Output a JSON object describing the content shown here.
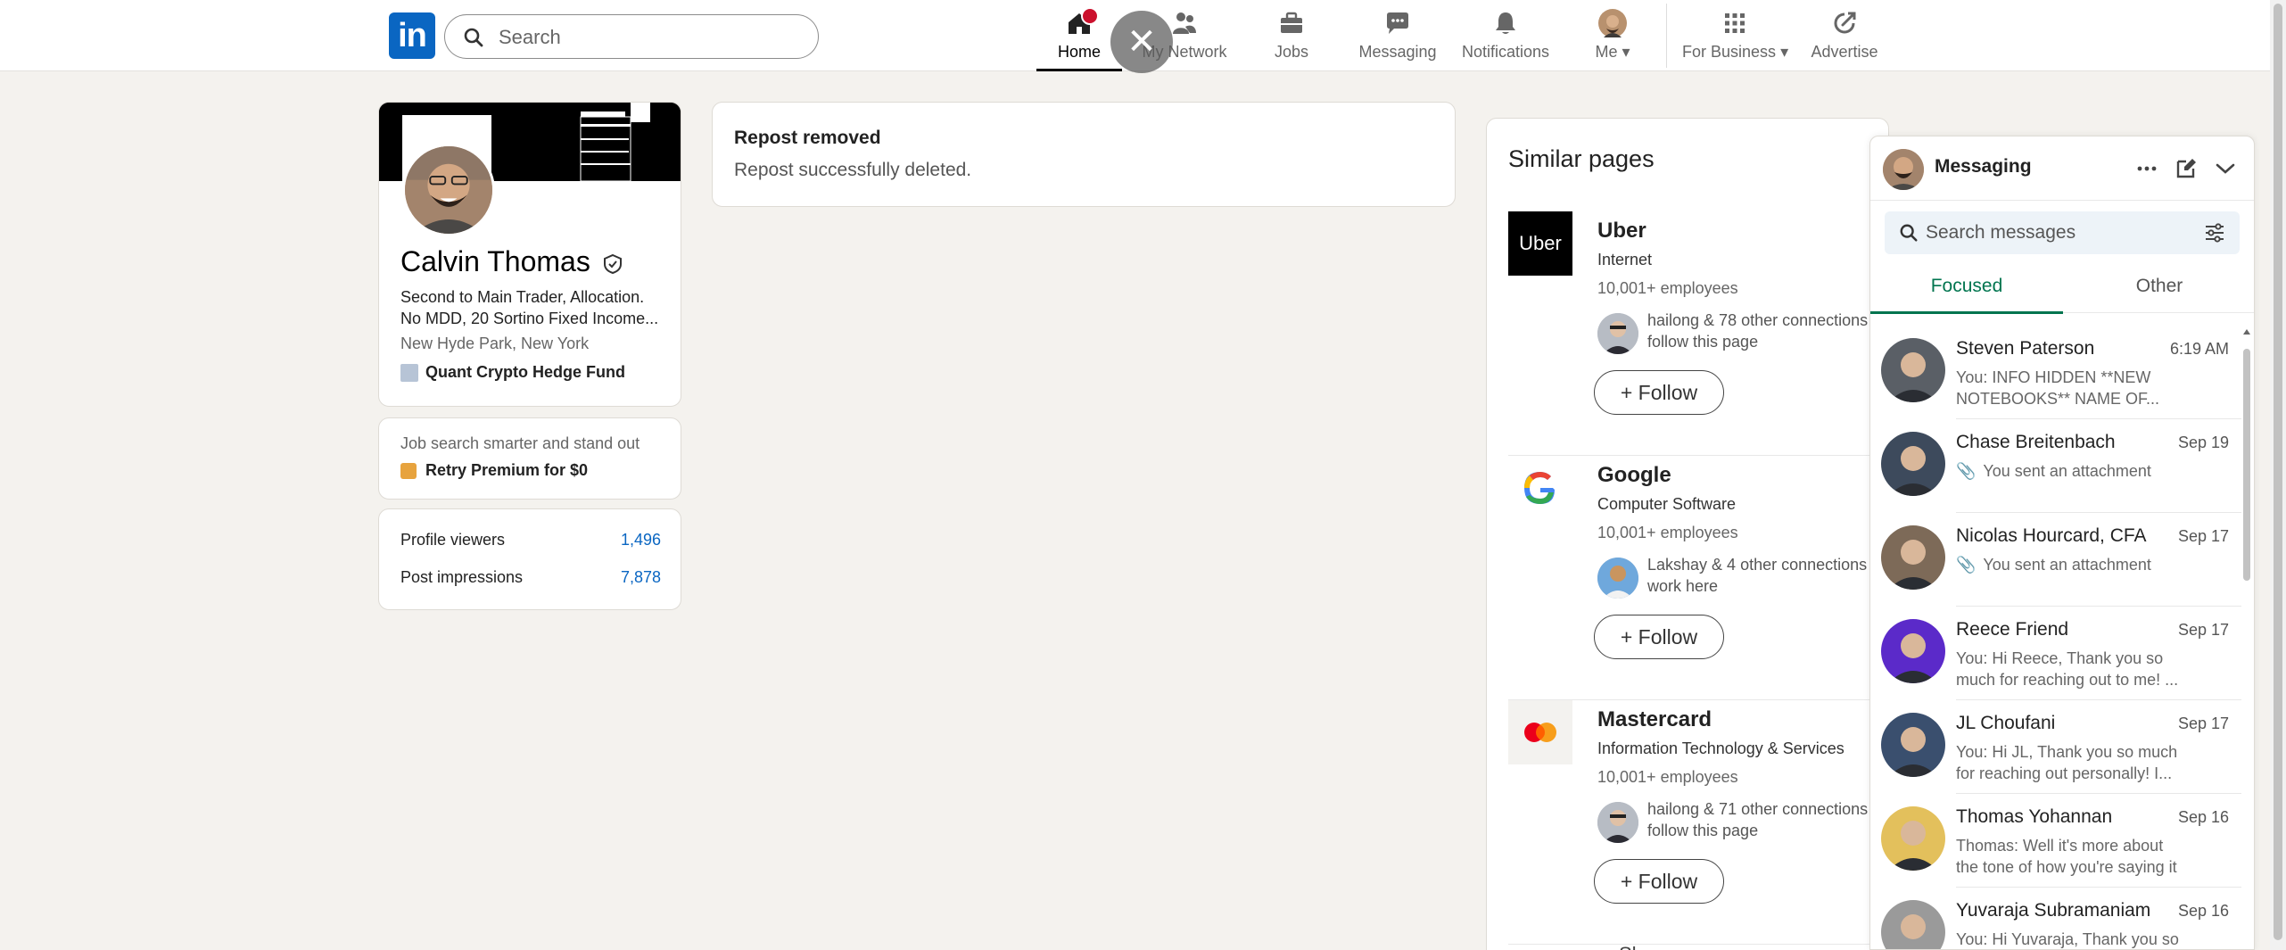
{
  "nav": {
    "logo": "in",
    "search_placeholder": "Search",
    "items": [
      {
        "label": "Home"
      },
      {
        "label": "My Network"
      },
      {
        "label": "Jobs"
      },
      {
        "label": "Messaging"
      },
      {
        "label": "Notifications"
      },
      {
        "label": "Me"
      },
      {
        "label": "For Business"
      },
      {
        "label": "Advertise"
      }
    ]
  },
  "profile": {
    "name": "Calvin Thomas",
    "headline": "Second to Main Trader, Allocation. No MDD, 20 Sortino Fixed Income...",
    "location": "New Hyde Park, New York",
    "org": "Quant Crypto Hedge Fund"
  },
  "premium": {
    "line": "Job search smarter and stand out",
    "cta": "Retry Premium for $0"
  },
  "stats": [
    {
      "label": "Profile viewers",
      "value": "1,496"
    },
    {
      "label": "Post impressions",
      "value": "7,878"
    }
  ],
  "toast": {
    "title": "Repost removed",
    "body": "Repost successfully deleted."
  },
  "similar": {
    "title": "Similar pages",
    "more": "Show more",
    "follow_label": "+ Follow",
    "companies": [
      {
        "name": "Uber",
        "logo_text": "Uber",
        "industry": "Internet",
        "employees": "10,001+ employees",
        "connections": "hailong & 78 other connections follow this page"
      },
      {
        "name": "Google",
        "logo_text": "G",
        "industry": "Computer Software",
        "employees": "10,001+ employees",
        "connections": "Lakshay & 4 other connections work here"
      },
      {
        "name": "Mastercard",
        "logo_text": "",
        "industry": "Information Technology & Services",
        "employees": "10,001+ employees",
        "connections": "hailong & 71 other connections follow this page"
      }
    ]
  },
  "messaging": {
    "title": "Messaging",
    "search_placeholder": "Search messages",
    "tabs": [
      {
        "label": "Focused"
      },
      {
        "label": "Other"
      }
    ],
    "conversations": [
      {
        "name": "Steven Paterson",
        "date": "6:19 AM",
        "preview": "You: INFO HIDDEN **NEW NOTEBOOKS** NAME OF...",
        "color": "#5a5f66"
      },
      {
        "name": "Chase Breitenbach",
        "date": "Sep 19",
        "preview": "You sent an attachment",
        "attach": true,
        "color": "#3d4a5c"
      },
      {
        "name": "Nicolas Hourcard, CFA",
        "date": "Sep 17",
        "preview": "You sent an attachment",
        "attach": true,
        "color": "#7d6a58"
      },
      {
        "name": "Reece Friend",
        "date": "Sep 17",
        "preview": "You: Hi Reece, Thank you so much for reaching out to me! ...",
        "color": "#5b2ac9"
      },
      {
        "name": "JL Choufani",
        "date": "Sep 17",
        "preview": "You: Hi JL, Thank you so much for reaching out personally! I...",
        "color": "#3a4f6e"
      },
      {
        "name": "Thomas Yohannan",
        "date": "Sep 16",
        "preview": "Thomas: Well it's more about the tone of how you're saying it",
        "color": "#e3c05c"
      },
      {
        "name": "Yuvaraja Subramaniam",
        "date": "Sep 16",
        "preview": "You: Hi Yuvaraja, Thank you so",
        "color": "#9a9a9a"
      }
    ]
  },
  "colors": {
    "brand": "#0a66c2",
    "focused_tab": "#01754f",
    "badge": "#cb112d"
  }
}
